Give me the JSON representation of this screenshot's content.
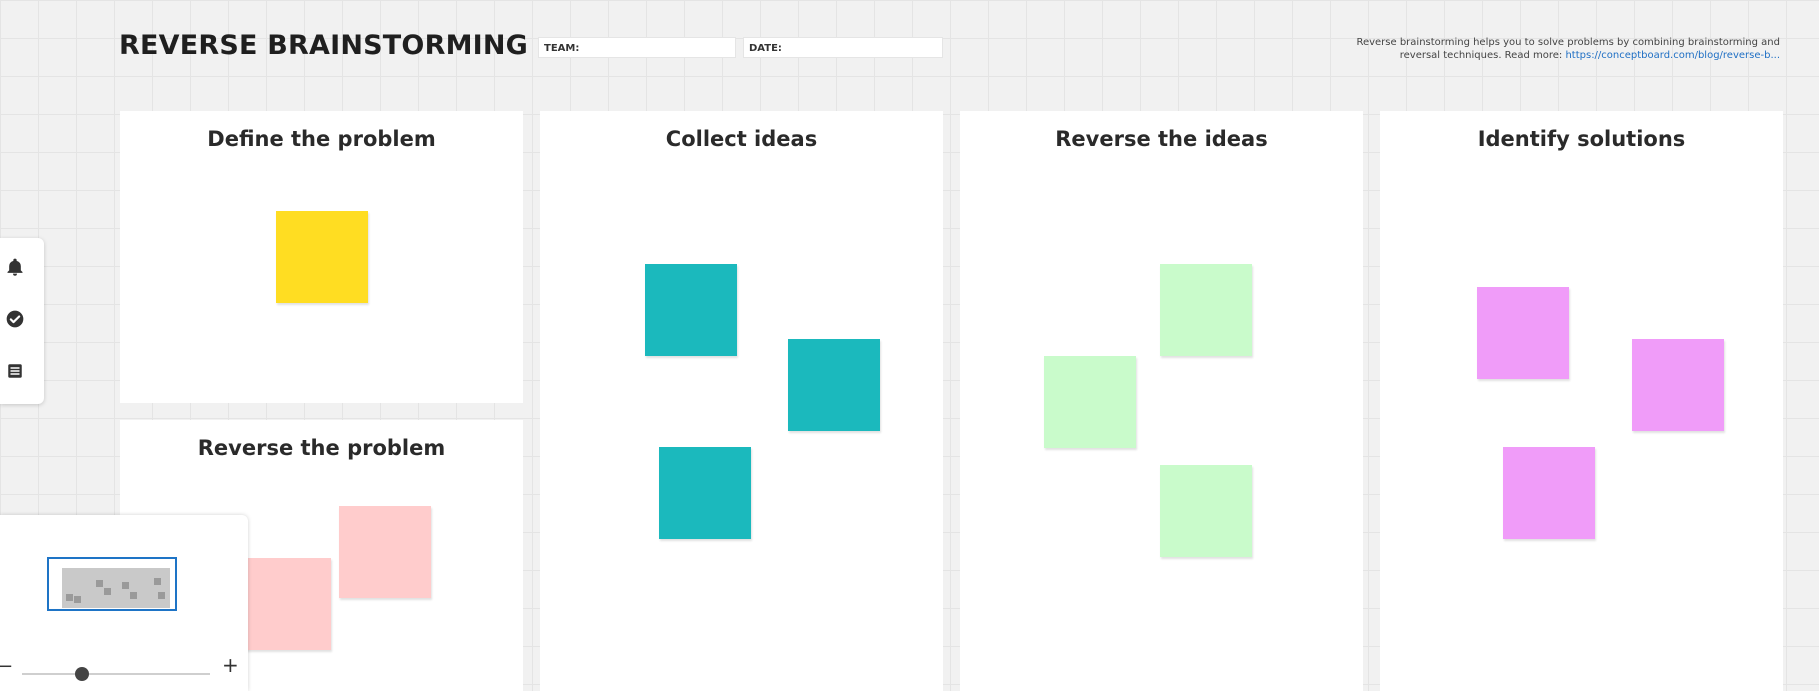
{
  "header": {
    "title": "REVERSE BRAINSTORMING",
    "team_label": "TEAM:",
    "date_label": "DATE:",
    "description": "Reverse brainstorming helps you to solve problems by combining brainstorming and reversal techniques. Read more:",
    "link": "https://conceptboard.com/blog/reverse-b..."
  },
  "panels": {
    "define": {
      "title": "Define the problem"
    },
    "reverse_problem": {
      "title": "Reverse the problem"
    },
    "collect": {
      "title": "Collect ideas"
    },
    "reverse_ideas": {
      "title": "Reverse the ideas"
    },
    "identify": {
      "title": "Identify solutions"
    }
  },
  "colors": {
    "yellow": "#ffdd22",
    "pink": "#ffcccc",
    "teal": "#1bb9bd",
    "mint": "#c9fbcb",
    "violet": "#f09cf9",
    "accent": "#1e74c6"
  },
  "toolbar": {
    "icons": [
      "bell-icon",
      "check-circle-icon",
      "list-icon"
    ]
  },
  "minimap": {
    "zoom_minus": "−",
    "zoom_plus": "+",
    "zoom_level": 0.3
  }
}
